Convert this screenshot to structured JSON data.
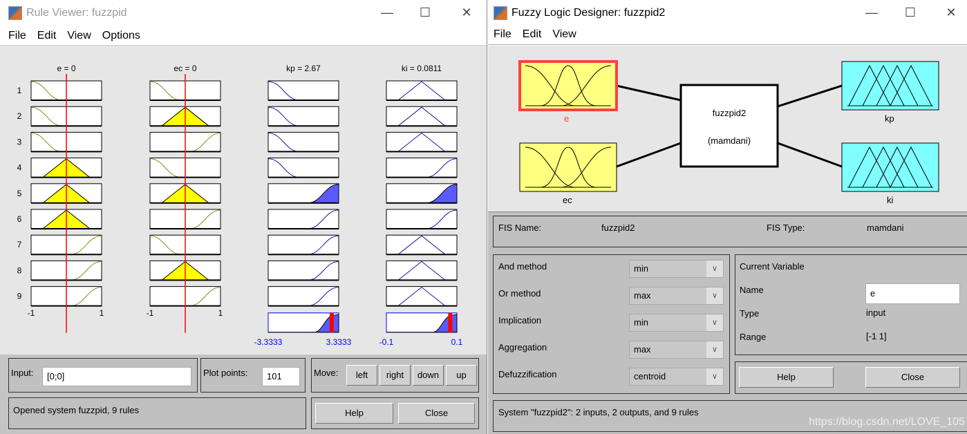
{
  "rule_viewer": {
    "title": "Rule Viewer: fuzzpid",
    "menu": [
      "File",
      "Edit",
      "View",
      "Options"
    ],
    "headers": [
      "e = 0",
      "ec = 0",
      "kp = 2.67",
      "ki = 0.0811"
    ],
    "rule_numbers": [
      "1",
      "2",
      "3",
      "4",
      "5",
      "6",
      "7",
      "8",
      "9"
    ],
    "input_ranges": [
      [
        "-1",
        "1"
      ],
      [
        "-1",
        "1"
      ]
    ],
    "output_ranges": [
      [
        "-3.3333",
        "3.3333"
      ],
      [
        "-0.1",
        "0.1"
      ]
    ],
    "input_values": [
      0,
      0
    ],
    "output_values": [
      2.67,
      0.0811
    ],
    "mf_shapes": {
      "e": [
        "z",
        "z",
        "z",
        "tri",
        "tri",
        "tri",
        "s",
        "s",
        "s"
      ],
      "ec": [
        "z",
        "tri",
        "s",
        "z",
        "tri",
        "s",
        "z",
        "tri",
        "s"
      ],
      "kp": [
        "z",
        "z",
        "z",
        "z",
        "s",
        "s",
        "s",
        "s",
        "s"
      ],
      "ki": [
        "tri",
        "tri",
        "tri",
        "s",
        "s",
        "s",
        "tri",
        "tri",
        "tri"
      ]
    },
    "fired_inputs": {
      "e": [
        4,
        5,
        6
      ],
      "ec": [
        2,
        5,
        8
      ]
    },
    "fired_outputs": [
      5
    ],
    "colors": {
      "input_mf": "#8a8a20",
      "input_fill": "#ffff00",
      "output_mf": "#1a1aa0",
      "output_fill": "#5a5aff",
      "marker": "#ff0000"
    },
    "input_label": "Input:",
    "input_value": "[0;0]",
    "plot_points_label": "Plot points:",
    "plot_points_value": "101",
    "move_label": "Move:",
    "move_buttons": [
      "left",
      "right",
      "down",
      "up"
    ],
    "status": "Opened system fuzzpid, 9 rules",
    "help": "Help",
    "close": "Close"
  },
  "fis_designer": {
    "title": "Fuzzy Logic Designer: fuzzpid2",
    "menu": [
      "File",
      "Edit",
      "View"
    ],
    "inputs": [
      "e",
      "ec"
    ],
    "outputs": [
      "kp",
      "ki"
    ],
    "system_name": "fuzzpid2",
    "system_type": "(mamdani)",
    "fis_name_label": "FIS Name:",
    "fis_name": "fuzzpid2",
    "fis_type_label": "FIS Type:",
    "fis_type": "mamdani",
    "methods": [
      {
        "label": "And method",
        "value": "min"
      },
      {
        "label": "Or method",
        "value": "max"
      },
      {
        "label": "Implication",
        "value": "min"
      },
      {
        "label": "Aggregation",
        "value": "max"
      },
      {
        "label": "Defuzzification",
        "value": "centroid"
      }
    ],
    "current_variable": "Current Variable",
    "name_label": "Name",
    "name_value": "e",
    "type_label": "Type",
    "type_value": "input",
    "range_label": "Range",
    "range_value": "[-1 1]",
    "help": "Help",
    "close": "Close",
    "status": "System \"fuzzpid2\": 2 inputs, 2 outputs, and 9 rules",
    "watermark": "https://blog.csdn.net/LOVE_105",
    "colors": {
      "input_box": "#ffff80",
      "output_box": "#80ffff",
      "selected_border": "#ff4040"
    }
  }
}
